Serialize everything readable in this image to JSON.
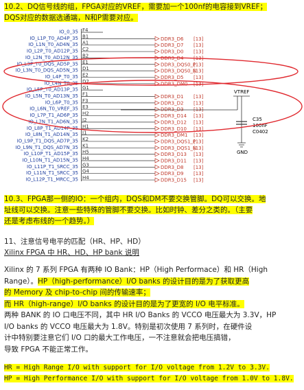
{
  "section1": {
    "line1": "10.2、DQ信号线的组，FPGA对应的VREF，需要加一个100nf的电容接到VREF；",
    "line2": "DQS对应的数据选通端，N和P需要对应。"
  },
  "schematic": {
    "pins": [
      {
        "io": "IO_0_35",
        "pin": "F4",
        "net": ""
      },
      {
        "io": "IO_L1P_T0_AD4P_35",
        "pin": "B1",
        "net": "DDR3_D6"
      },
      {
        "io": "IO_L1N_T0_AD4N_35",
        "pin": "A1",
        "net": "DDR3_D7"
      },
      {
        "io": "IO_L2P_T0_AD12P_35",
        "pin": "C2",
        "net": "DDR3_D0"
      },
      {
        "io": "IO_L2N_T0_AD12N_35",
        "pin": "B2",
        "net": "DDR3_D4"
      },
      {
        "io": "IO_L3P_T0_DQS_AD5P_35",
        "pin": "E1",
        "net": "DDR3_DQS0_P"
      },
      {
        "io": "IO_L3N_T0_DQS_AD5N_35",
        "pin": "D1",
        "net": "DDR3_DQS0_N"
      },
      {
        "io": "IO_L4P_T0_35",
        "pin": "E2",
        "net": "DDR3_D5"
      },
      {
        "io": "IO_L4N_T0_35",
        "pin": "D2",
        "net": "DDR3_DM0"
      },
      {
        "io": "IO_L5P_T0_AD13P_35",
        "pin": "G1",
        "net": ""
      },
      {
        "io": "IO_L5N_T0_AD13N_35",
        "pin": "F1",
        "net": "DDR3_D1"
      },
      {
        "io": "IO_L6P_T0_35",
        "pin": "F3",
        "net": "DDR3_D2"
      },
      {
        "io": "IO_L6N_T0_VREF_35",
        "pin": "E3",
        "net": "DDR3_D3"
      },
      {
        "io": "IO_L7P_T1_AD6P_35",
        "pin": "H2",
        "net": "DDR3_D14"
      },
      {
        "io": "IO_L7N_T1_AD6N_35",
        "pin": "J2",
        "net": "DDR3_D12"
      },
      {
        "io": "IO_L8P_T1_AD14P_35",
        "pin": "H1",
        "net": "DDR3_D10"
      },
      {
        "io": "IO_L8N_T1_AD14N_35",
        "pin": "J1",
        "net": "DDR3_DM1"
      },
      {
        "io": "IO_L9P_T1_DQS_AD7P_35",
        "pin": "K2",
        "net": "DDR3_DQS1_P"
      },
      {
        "io": "IO_L9N_T1_DQS_AD7N_35",
        "pin": "K1",
        "net": "DDR3_DQS1_N"
      },
      {
        "io": "IO_L10P_T1_AD15P_35",
        "pin": "H5",
        "net": "DDR3_D13"
      },
      {
        "io": "IO_L10N_T1_AD15N_35",
        "pin": "H4",
        "net": "DDR3_D11"
      },
      {
        "io": "IO_L11P_T1_SRCC_35",
        "pin": "G3",
        "net": "DDR3_D8"
      },
      {
        "io": "IO_L11N_T1_SRCC_35",
        "pin": "G4",
        "net": "DDR3_D9"
      },
      {
        "io": "IO_L12P_T1_MRCC_35",
        "pin": "H4",
        "net": "DDR3_D15"
      }
    ],
    "sheet_ref": "[13]",
    "vtref_label": "VTREF",
    "cap_ref": "C35",
    "cap_value": "100nF",
    "cap_package": "C0402",
    "gnd_label": "GND"
  },
  "section2": {
    "line1": "10.3、FPGA那一侧的IO：一个组内，DQS和DM不要交换管脚。DQ可以交换。地",
    "line2": "址线可以交换。注意一些特殊的管脚不要交换。比如时钟、差分之类的。（主要",
    "line3": "还是考虑布线的一个趋势。）"
  },
  "section3": {
    "heading": "11、注意信号电平的匹配（HR、HP、HD）",
    "subheading": "Xilinx FPGA 中 HR、HD、HP bank 说明"
  },
  "section4": {
    "line1": "Xilinx 的 7 系列 FPGA 有两种 IO Bank：HP（High Performace）和 HR（High",
    "line2a": "Range）。",
    "line2b": "HP（high-performance）I/O banks 的设计目的是为了获取更高",
    "line3": "的 Memory 及 chip-to-chip 间的传输速率；",
    "line4": "而 HR（high-range）I/O banks 的设计目的是为了更宽的 I/O 电平标准。",
    "line5": "两种 BANK 的 IO 口电压不同，其中 HR I/O Banks 的 VCCO 电压最大为 3.3V，HP",
    "line6": "I/O banks 的 VCCO 电压最大为 1.8V。特别是初次使用 7 系列时，在硬件设",
    "line7": "计中特别要注意它们 I/O 口的最大工作电压，一不注意就会把电压搞错，",
    "line8": "导致 FPGA 不能正常工作。"
  },
  "section5": {
    "line1": "HR = High Range I/O with support for I/O voltage from 1.2V to 3.3V.",
    "line2": "HP = High Performance I/O with support for I/O voltage from 1.0V to 1.8V."
  },
  "colors": {
    "highlight": "#ffff00",
    "annotation": "#e0282e",
    "net_label": "#c0392b",
    "io_label": "#1f3fa0"
  }
}
